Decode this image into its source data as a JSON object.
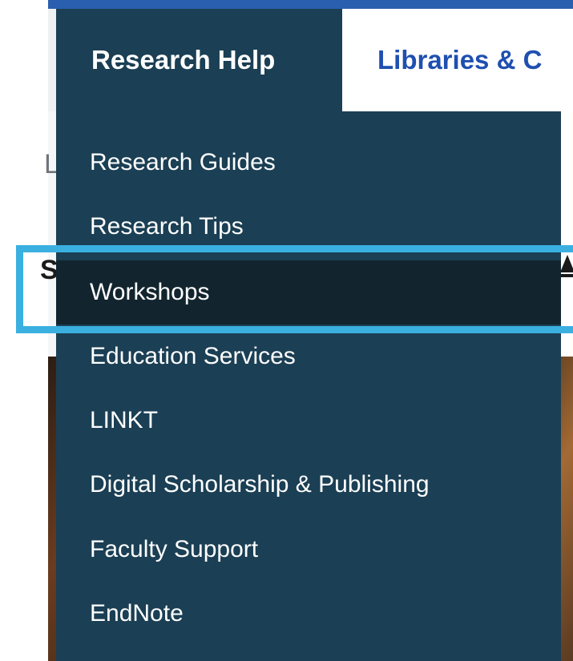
{
  "nav": {
    "tabs": [
      {
        "label": "Research Help",
        "active": true
      },
      {
        "label": "Libraries & C",
        "active": false
      }
    ]
  },
  "page_behind": {
    "partial_glyph_1": "L",
    "partial_glyph_2": "S"
  },
  "menu": {
    "items": [
      {
        "label": "Research Guides"
      },
      {
        "label": "Research Tips"
      },
      {
        "label": "Workshops",
        "highlighted": true
      },
      {
        "label": "Education Services"
      },
      {
        "label": "LINKT"
      },
      {
        "label": "Digital Scholarship & Publishing"
      },
      {
        "label": "Faculty Support"
      },
      {
        "label": "EndNote"
      }
    ]
  },
  "colors": {
    "menu_background": "#1b3f54",
    "hover_background": "#12252f",
    "inactive_tab_text": "#1f4fb0",
    "highlight_border": "#3ab0e0",
    "top_rule": "#2a5fb0"
  }
}
